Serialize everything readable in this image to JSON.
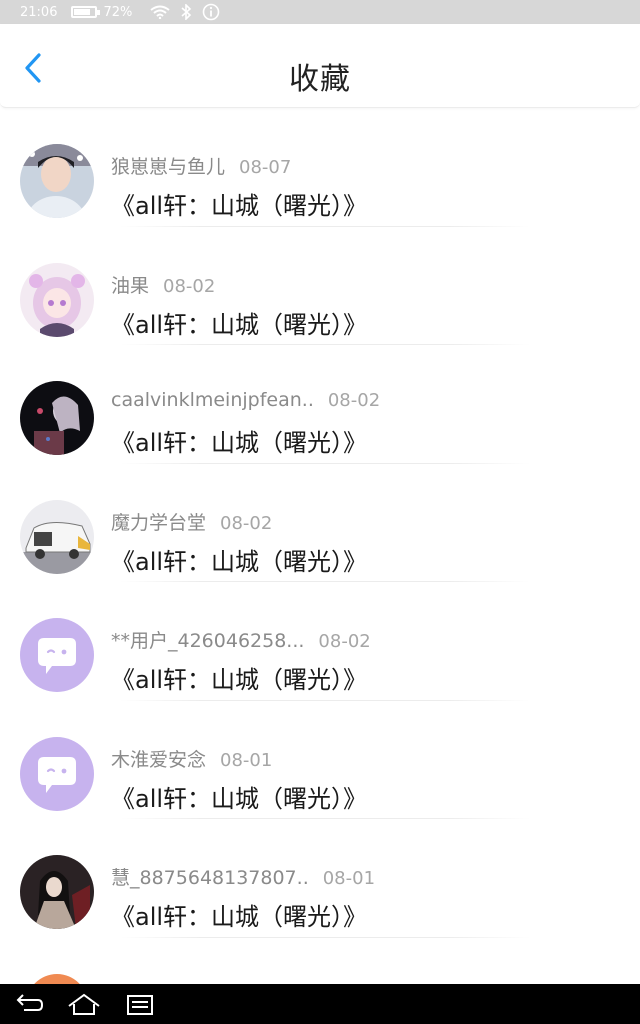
{
  "status_bar": {
    "time": "21:06",
    "battery": "72%",
    "battery_level": 0.72
  },
  "header": {
    "title": "收藏"
  },
  "favorites": [
    {
      "user": "狼崽崽与鱼儿",
      "date": "08-07",
      "title": "《all轩：山城（曙光）》",
      "avatar": "photo-boy"
    },
    {
      "user": "油果",
      "date": "08-02",
      "title": "《all轩：山城（曙光）》",
      "avatar": "anime-girl"
    },
    {
      "user": "caalvinklmeinjpfean..",
      "date": "08-02",
      "title": "《all轩：山城（曙光）》",
      "avatar": "dark-photo"
    },
    {
      "user": "魔力学台堂",
      "date": "08-02",
      "title": "《all轩：山城（曙光）》",
      "avatar": "car-photo"
    },
    {
      "user": "**用户_426046258...",
      "date": "08-02",
      "title": "《all轩：山城（曙光）》",
      "avatar": "default-chat-bubble"
    },
    {
      "user": "木淮爱安念",
      "date": "08-01",
      "title": "《all轩：山城（曙光）》",
      "avatar": "default-chat-bubble"
    },
    {
      "user": "慧_8875648137807..",
      "date": "08-01",
      "title": "《all轩：山城（曙光）》",
      "avatar": "costume-photo"
    }
  ],
  "colors": {
    "accent": "#2196f3",
    "default_avatar": "#c7b3ee"
  }
}
